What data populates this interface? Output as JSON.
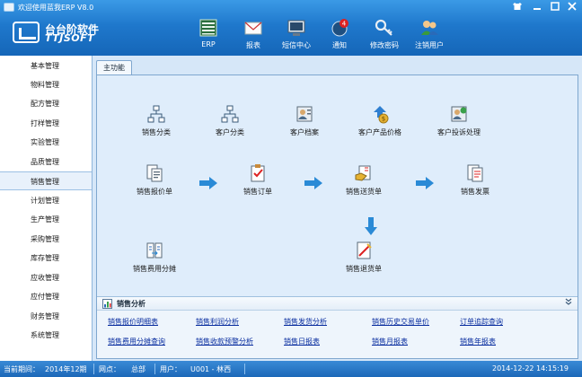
{
  "window": {
    "title": "欢迎使用蓝我ERP V8.0"
  },
  "logo": {
    "cn": "台台阶软件",
    "en": "TTJSOFT"
  },
  "toolbar": {
    "items": [
      {
        "label": "ERP",
        "icon": "erp-icon"
      },
      {
        "label": "报表",
        "icon": "report-mail-icon"
      },
      {
        "label": "短信中心",
        "icon": "sms-center-icon"
      },
      {
        "label": "通知",
        "icon": "notification-icon",
        "badge": "4"
      },
      {
        "label": "修改密码",
        "icon": "key-icon"
      },
      {
        "label": "注销用户",
        "icon": "logout-users-icon"
      }
    ]
  },
  "sidebar": {
    "items": [
      {
        "label": "基本管理"
      },
      {
        "label": "物料管理"
      },
      {
        "label": "配方管理"
      },
      {
        "label": "打样管理"
      },
      {
        "label": "实验管理"
      },
      {
        "label": "品质管理"
      },
      {
        "label": "销售管理",
        "active": true
      },
      {
        "label": "计划管理"
      },
      {
        "label": "生产管理"
      },
      {
        "label": "采购管理"
      },
      {
        "label": "库存管理"
      },
      {
        "label": "应收管理"
      },
      {
        "label": "应付管理"
      },
      {
        "label": "财务管理"
      },
      {
        "label": "系统管理"
      }
    ]
  },
  "main": {
    "tab_label": "主功能",
    "functions": {
      "sales_category": "销售分类",
      "customer_category": "客户分类",
      "customer_archive": "客户档案",
      "customer_product_price": "客户产品价格",
      "customer_complaint": "客户投诉处理",
      "sales_quote": "销售报价单",
      "sales_order": "销售订单",
      "sales_delivery": "销售送货单",
      "sales_invoice": "销售发票",
      "sales_expense": "销售费用分摊",
      "sales_return": "销售退货单"
    }
  },
  "analysis": {
    "title": "销售分析",
    "links_row1": [
      "销售报价明细表",
      "销售利润分析",
      "销售发货分析",
      "销售历史交易单价",
      "订单追踪查询"
    ],
    "links_row2": [
      "销售费用分摊查询",
      "销售收款预警分析",
      "销售日报表",
      "销售月报表",
      "销售年报表"
    ]
  },
  "status": {
    "period_label": "当前期间：",
    "period_value": "2014年12期",
    "site_label": "网点：",
    "site_value": "总部",
    "user_label": "用户：",
    "user_value": "U001 - 林西",
    "datetime": "2014-12-22 14:15:19"
  },
  "colors": {
    "header": "#1f78cc",
    "main_bg": "#dfedfb",
    "arrow": "#2a8ad6",
    "link": "#0b2fa0"
  }
}
